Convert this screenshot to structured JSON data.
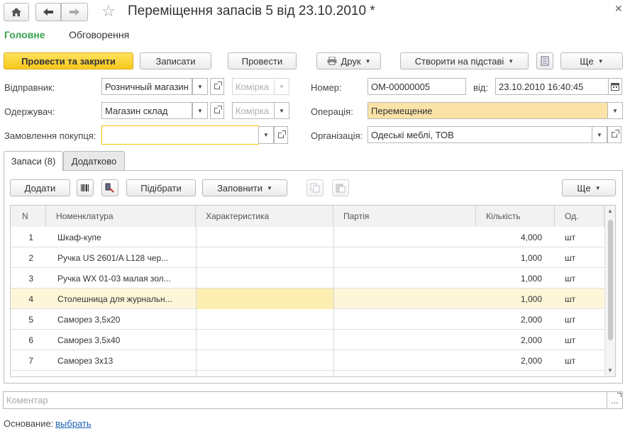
{
  "window": {
    "title": "Переміщення запасів 5 від 23.10.2010 *"
  },
  "nav_tabs": {
    "main": "Головне",
    "discussion": "Обговорення"
  },
  "toolbar": {
    "post_close": "Провести та закрити",
    "save": "Записати",
    "post": "Провести",
    "print": "Друк",
    "create_based": "Створити на підставі",
    "more": "Ще"
  },
  "form": {
    "sender_label": "Відправник:",
    "sender_value": "Розничный магазин",
    "sender_cell_placeholder": "Комірка",
    "receiver_label": "Одержувач:",
    "receiver_value": "Магазин склад",
    "receiver_cell_placeholder": "Комірка",
    "order_label": "Замовлення покупця:",
    "order_value": "",
    "number_label": "Номер:",
    "number_value": "ОМ-00000005",
    "date_label": "від:",
    "date_value": "23.10.2010 16:40:45",
    "operation_label": "Операція:",
    "operation_value": "Перемещение",
    "organization_label": "Організація:",
    "organization_value": "Одеські меблі, ТОВ"
  },
  "section_tabs": {
    "stock": "Запаси (8)",
    "additional": "Додатково"
  },
  "table_toolbar": {
    "add": "Додати",
    "pick": "Підібрати",
    "fill": "Заповнити",
    "more": "Ще"
  },
  "table": {
    "columns": [
      "N",
      "Номенклатура",
      "Характеристика",
      "Партія",
      "Кількість",
      "Од."
    ],
    "rows": [
      {
        "n": "1",
        "name": "Шкаф-купе",
        "char": "",
        "batch": "",
        "qty": "4,000",
        "unit": "шт"
      },
      {
        "n": "2",
        "name": "Ручка US 2601/A L128 чер...",
        "char": "",
        "batch": "",
        "qty": "1,000",
        "unit": "шт"
      },
      {
        "n": "3",
        "name": "Ручка WX 01-03 малая зол...",
        "char": "",
        "batch": "",
        "qty": "1,000",
        "unit": "шт"
      },
      {
        "n": "4",
        "name": "Столешница для журнальн...",
        "char": "",
        "batch": "",
        "qty": "1,000",
        "unit": "шт"
      },
      {
        "n": "5",
        "name": "Саморез 3,5х20",
        "char": "",
        "batch": "",
        "qty": "2,000",
        "unit": "шт"
      },
      {
        "n": "6",
        "name": "Саморез 3,5х40",
        "char": "",
        "batch": "",
        "qty": "2,000",
        "unit": "шт"
      },
      {
        "n": "7",
        "name": "Саморез 3х13",
        "char": "",
        "batch": "",
        "qty": "2,000",
        "unit": "шт"
      }
    ],
    "selected_row": 3
  },
  "comment": {
    "placeholder": "Коментар",
    "button": "..."
  },
  "basis": {
    "label": "Основание:",
    "link": "выбрать"
  },
  "colors": {
    "accent_green": "#3aa350",
    "primary_yellow": "#f8c81c",
    "selected_row": "#fdf6d8",
    "link": "#1a5fb4"
  }
}
